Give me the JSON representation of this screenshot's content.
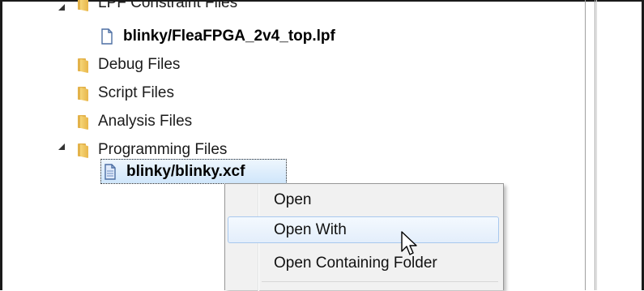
{
  "tree": {
    "items": [
      {
        "label": "LPF Constraint Files",
        "kind": "folder",
        "expanded": true
      },
      {
        "label": "blinky/FleaFPGA_2v4_top.lpf",
        "kind": "file",
        "bold": true
      },
      {
        "label": "Debug Files",
        "kind": "folder"
      },
      {
        "label": "Script Files",
        "kind": "folder"
      },
      {
        "label": "Analysis Files",
        "kind": "folder"
      },
      {
        "label": "Programming Files",
        "kind": "folder",
        "expanded": true
      },
      {
        "label": "blinky/blinky.xcf",
        "kind": "file",
        "bold": true,
        "selected": true
      }
    ]
  },
  "context_menu": {
    "items": [
      {
        "label": "Open"
      },
      {
        "label": "Open With",
        "hovered": true
      },
      {
        "label": "Open Containing Folder"
      }
    ]
  },
  "colors": {
    "selection_bg": "#cfe6fb",
    "menu_bg": "#f1f1f1",
    "menu_hover_border": "#a8c8ee",
    "folder": "#e8b64a",
    "file_icon": "#4d6fa3"
  }
}
